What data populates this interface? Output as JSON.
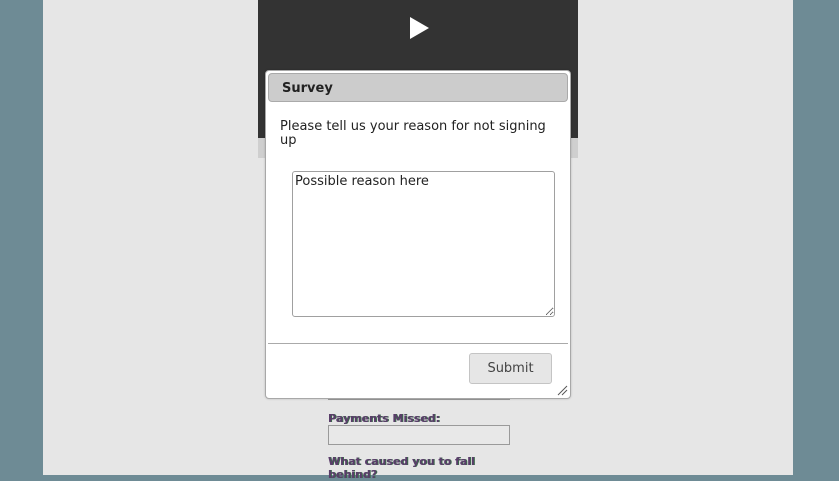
{
  "background": {
    "outer_color": "#6e8b95",
    "page_color": "#e6e6e6"
  },
  "video": {
    "play_icon": "play-icon",
    "bg_color": "#333333"
  },
  "form": {
    "payments_missed_label": "Payments Missed:",
    "fall_behind_label": "What caused you to fall behind?"
  },
  "dialog": {
    "title": "Survey",
    "prompt": "Please tell us your reason for not signing up",
    "textarea_value": "Possible reason here",
    "submit_label": "Submit",
    "resize_icon": "resize-grip-icon"
  }
}
